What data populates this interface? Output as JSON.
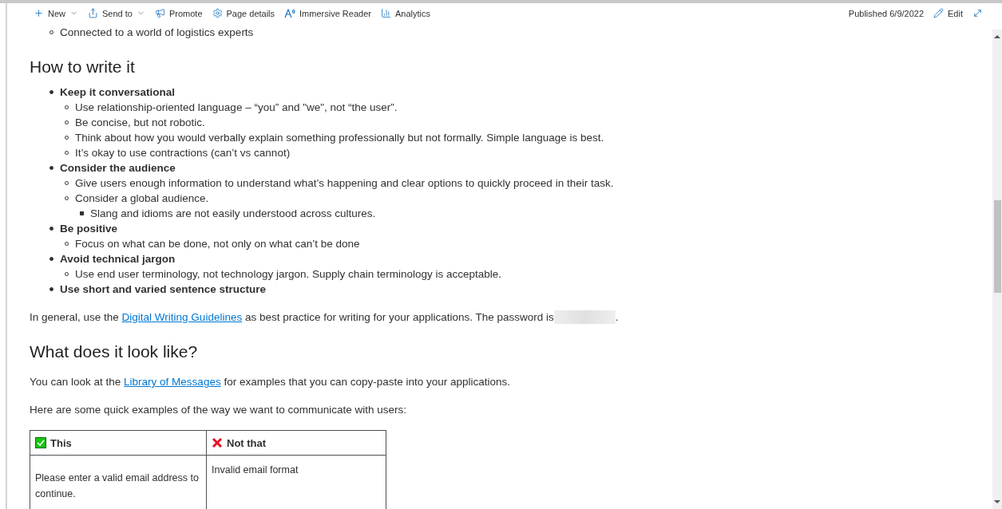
{
  "toolbar": {
    "items": [
      {
        "kind": "plus",
        "label": "New",
        "dropdown": true
      },
      {
        "kind": "send",
        "label": "Send to",
        "dropdown": true
      },
      {
        "kind": "megaphone",
        "label": "Promote",
        "dropdown": false
      },
      {
        "kind": "gear",
        "label": "Page details",
        "dropdown": false
      },
      {
        "kind": "reader",
        "label": "Immersive Reader",
        "dropdown": false
      },
      {
        "kind": "chart",
        "label": "Analytics",
        "dropdown": false
      }
    ],
    "published": "Published 6/9/2022",
    "edit": "Edit"
  },
  "content": [
    {
      "kind": "sublist",
      "items": [
        {
          "text": "Connected to a world of logistics experts",
          "bold": false
        }
      ]
    },
    {
      "kind": "heading",
      "text": "How to write it"
    },
    {
      "kind": "list",
      "items": [
        {
          "text": "Keep it conversational",
          "bold": true,
          "children": [
            {
              "text": "Use relationship-oriented language – “you” and \"we\", not “the user”.",
              "bold": false
            },
            {
              "text": "Be concise, but not robotic.",
              "bold": false
            },
            {
              "text": "Think about how you would verbally explain something professionally but not formally. Simple language is best.",
              "bold": false
            },
            {
              "text": "It’s okay to use contractions (can’t vs cannot)",
              "bold": false
            }
          ]
        },
        {
          "text": "Consider the audience",
          "bold": true,
          "children": [
            {
              "text": "Give users enough information to understand what’s happening and clear options to quickly proceed in their task.",
              "bold": false
            },
            {
              "text": "Consider a global audience.",
              "bold": false,
              "children": [
                {
                  "text": "Slang and idioms are not easily understood across cultures.",
                  "bold": false
                }
              ]
            }
          ]
        },
        {
          "text": "Be positive",
          "bold": true,
          "children": [
            {
              "text": "Focus on what can be done, not only on what can’t be done",
              "bold": false
            }
          ]
        },
        {
          "text": "Avoid technical jargon",
          "bold": true,
          "children": [
            {
              "text": "Use end user terminology, not technology jargon. Supply chain terminology is acceptable.",
              "bold": false
            }
          ]
        },
        {
          "text": "Use short and varied sentence structure",
          "bold": true
        }
      ]
    },
    {
      "kind": "paragraph",
      "parts": [
        {
          "kind": "text",
          "text": "In general, use the "
        },
        {
          "kind": "link",
          "text": "Digital Writing Guidelines"
        },
        {
          "kind": "text",
          "text": " as best practice for writing for your applications. The password is"
        },
        {
          "kind": "redacted"
        },
        {
          "kind": "text",
          "text": "."
        }
      ]
    },
    {
      "kind": "heading",
      "text": "What does it look like?"
    },
    {
      "kind": "paragraph",
      "parts": [
        {
          "kind": "text",
          "text": "You can look at the "
        },
        {
          "kind": "link",
          "text": "Library of Messages"
        },
        {
          "kind": "text",
          "text": " for examples that you can copy-paste into your applications."
        }
      ]
    },
    {
      "kind": "paragraph",
      "parts": [
        {
          "kind": "text",
          "text": "Here are some quick examples of the way we want to communicate with users:"
        }
      ]
    },
    {
      "kind": "table",
      "columns": [
        {
          "kind": "check",
          "label": "This"
        },
        {
          "kind": "cross",
          "label": "Not that"
        }
      ],
      "rows": [
        [
          "Please enter a valid email address to continue.",
          "Invalid email format"
        ]
      ]
    }
  ]
}
